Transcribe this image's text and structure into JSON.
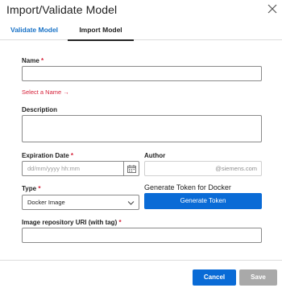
{
  "dialog": {
    "title": "Import/Validate Model",
    "close_icon": "close-icon"
  },
  "tabs": [
    {
      "label": "Validate Model",
      "active": false
    },
    {
      "label": "Import Model",
      "active": true
    }
  ],
  "form": {
    "name": {
      "label": "Name",
      "required": "*",
      "value": "",
      "error": "Select a Name →"
    },
    "description": {
      "label": "Description",
      "value": ""
    },
    "expiration_date": {
      "label": "Expiration Date",
      "required": "*",
      "placeholder": "dd/mm/yyyy hh:mm",
      "icon": "calendar-icon"
    },
    "author": {
      "label": "Author",
      "value": "@siemens.com"
    },
    "type": {
      "label": "Type",
      "required": "*",
      "selected": "Docker Image",
      "icon": "chevron-down-icon"
    },
    "generate_token": {
      "label": "Generate Token for Docker",
      "button_label": "Generate Token"
    },
    "image_uri": {
      "label": "Image repository URI (with tag)",
      "required": "*",
      "value": ""
    }
  },
  "footer": {
    "cancel_label": "Cancel",
    "save_label": "Save"
  },
  "colors": {
    "accent": "#0a6bd6",
    "tab_active_text": "#1a73c7",
    "error": "#d6223a",
    "disabled": "#a9a9a9"
  }
}
